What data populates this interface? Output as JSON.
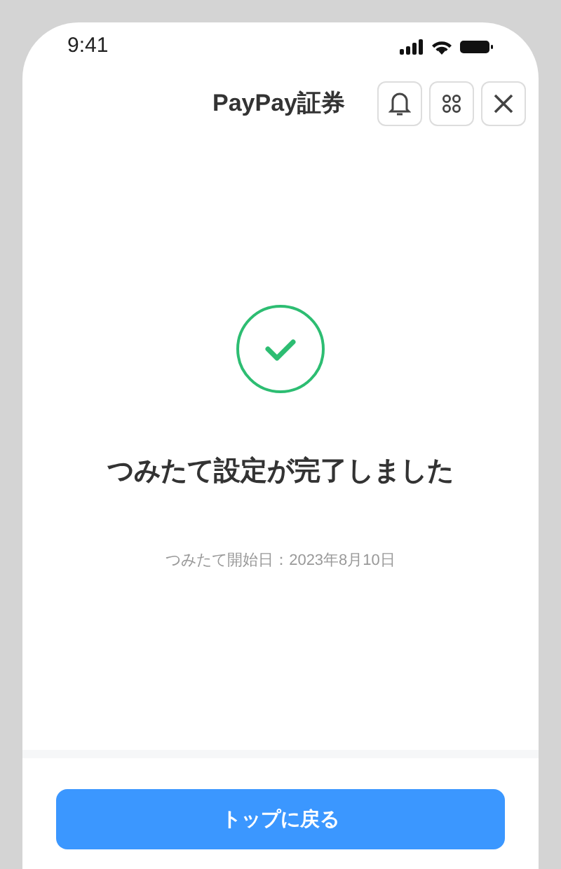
{
  "status_bar": {
    "time": "9:41"
  },
  "header": {
    "title": "PayPay証券"
  },
  "message": {
    "title": "つみたて設定が完了しました",
    "start_date": "つみたて開始日：2023年8月10日"
  },
  "footer": {
    "button": "トップに戻る"
  }
}
